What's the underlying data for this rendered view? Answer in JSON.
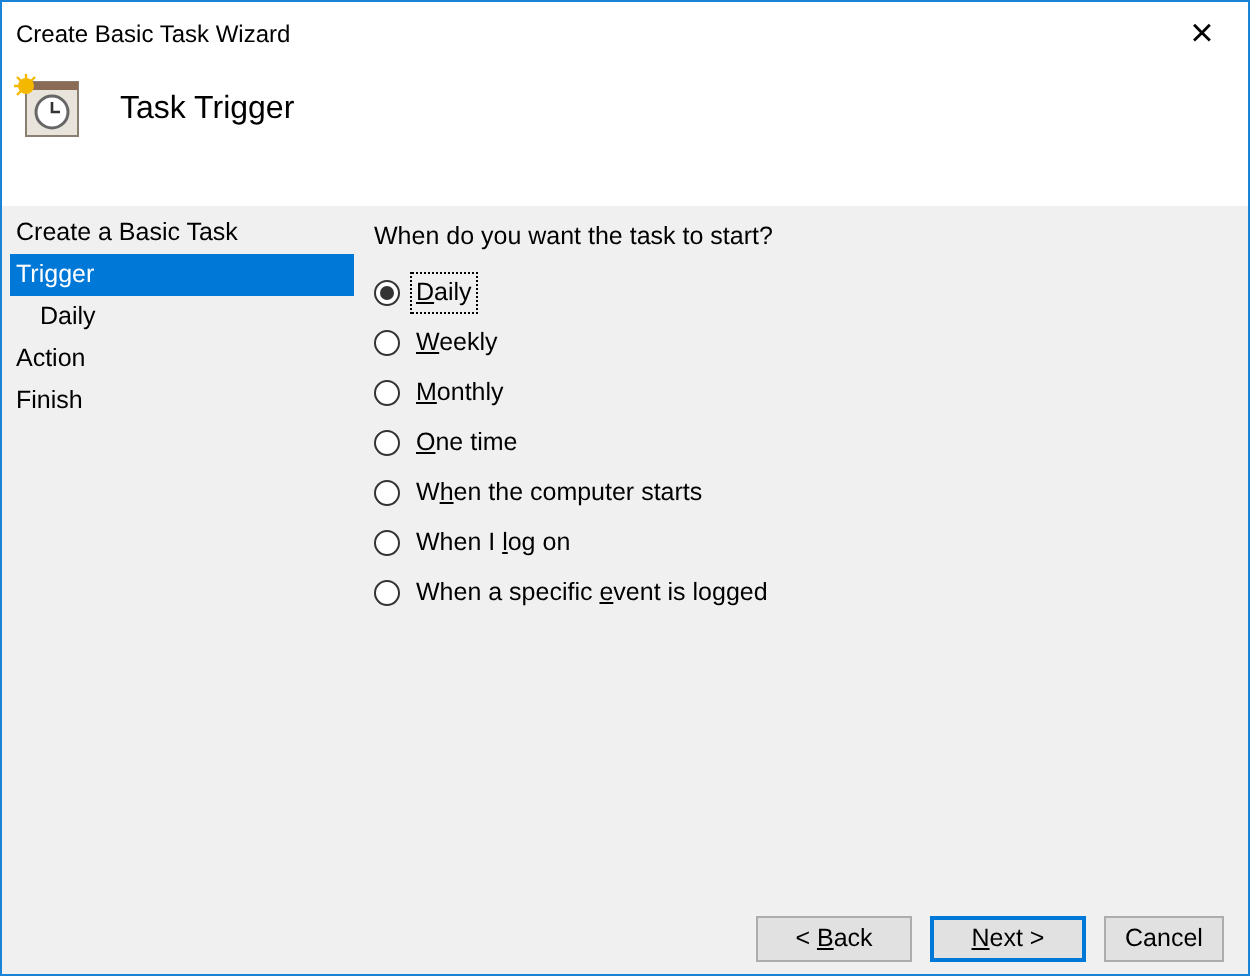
{
  "window": {
    "title": "Create Basic Task Wizard",
    "close": "×"
  },
  "header": {
    "title": "Task Trigger"
  },
  "sidebar": {
    "items": [
      {
        "label": "Create a Basic Task",
        "selected": false
      },
      {
        "label": "Trigger",
        "selected": true,
        "children": [
          {
            "label": "Daily",
            "selected": false
          }
        ]
      },
      {
        "label": "Action",
        "selected": false
      },
      {
        "label": "Finish",
        "selected": false
      }
    ]
  },
  "question": "When do you want the task to start?",
  "options": [
    {
      "label": {
        "key": "D",
        "after": "aily"
      },
      "selected": true
    },
    {
      "label": {
        "key": "W",
        "after": "eekly"
      },
      "selected": false
    },
    {
      "label": {
        "key": "M",
        "after": "onthly"
      },
      "selected": false
    },
    {
      "label": {
        "key": "O",
        "after": "ne time"
      },
      "selected": false
    },
    {
      "label": {
        "before": "W",
        "key": "h",
        "after": "en the computer starts"
      },
      "selected": false
    },
    {
      "label": {
        "before": "When I ",
        "key": "l",
        "after": "og on"
      },
      "selected": false
    },
    {
      "label": {
        "before": "When a specific ",
        "key": "e",
        "after": "vent is logged"
      },
      "selected": false
    }
  ],
  "buttons": [
    {
      "label": {
        "before": "< ",
        "key": "B",
        "after": "ack"
      },
      "default": false
    },
    {
      "label": {
        "key": "N",
        "after": "ext >"
      },
      "default": true
    },
    {
      "label": {
        "before": "Cancel"
      },
      "default": false
    }
  ]
}
